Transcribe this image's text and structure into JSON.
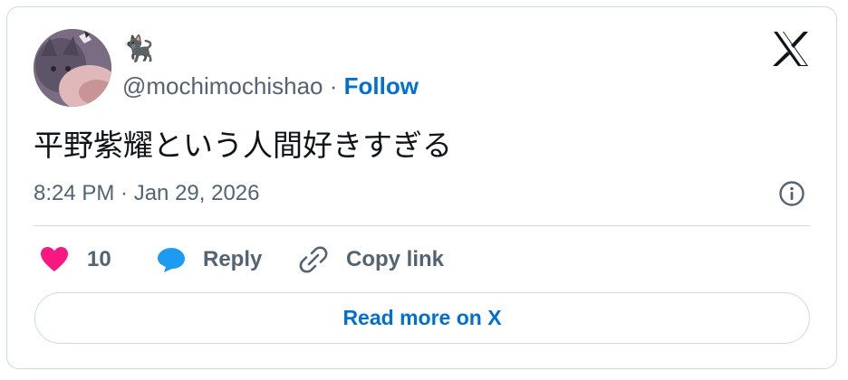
{
  "author": {
    "display_name": "🐈‍⬛",
    "handle": "@mochimochishao",
    "separator": "·",
    "follow_label": "Follow"
  },
  "tweet": {
    "text": "平野紫耀という人間好きすぎる",
    "timestamp": "8:24 PM · Jan 29, 2026"
  },
  "actions": {
    "like_count": "10",
    "reply_label": "Reply",
    "copy_link_label": "Copy link"
  },
  "footer": {
    "read_more_label": "Read more on X"
  },
  "icons": {
    "logo": "x-logo-icon",
    "info": "info-icon",
    "like": "heart-icon",
    "reply": "speech-bubble-icon",
    "copy": "link-icon"
  },
  "colors": {
    "like": "#f91880",
    "reply": "#1d9bf0",
    "link": "#006fd6",
    "muted": "#536471",
    "border": "#cfd9de"
  }
}
